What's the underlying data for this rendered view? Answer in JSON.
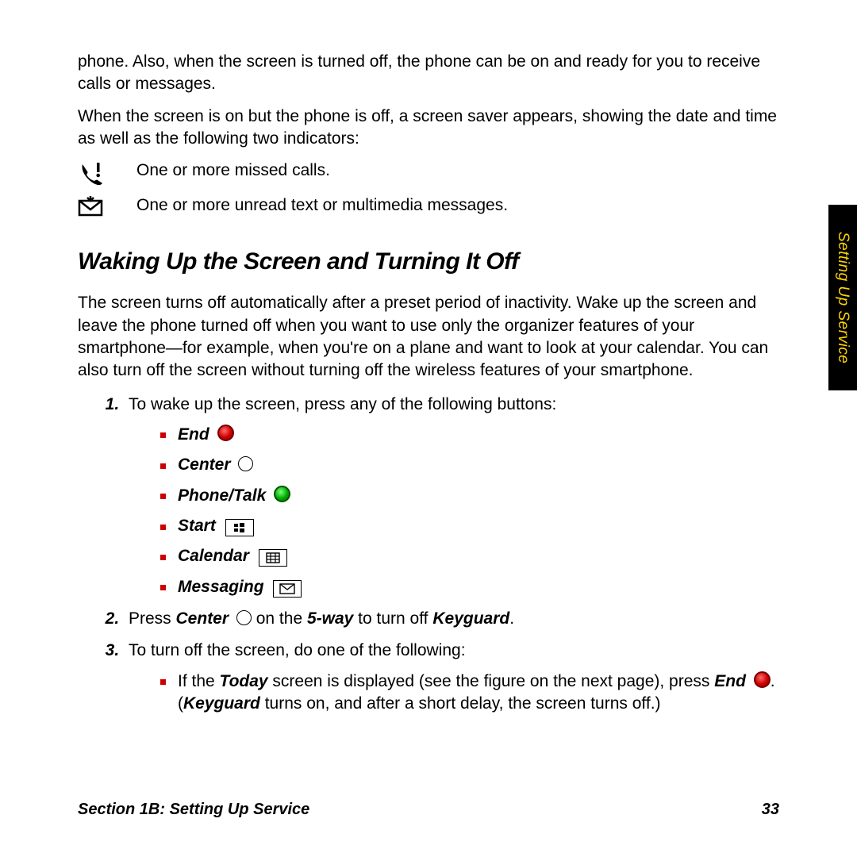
{
  "intro_paragraphs": [
    "phone. Also, when the screen is turned off, the phone can be on and ready for you to receive calls or messages.",
    "When the screen is on but the phone is off, a screen saver appears, showing the date and time as well as the following two indicators:"
  ],
  "indicators": [
    {
      "text": "One or more missed calls."
    },
    {
      "text": "One or more unread text or multimedia messages."
    }
  ],
  "heading": "Waking Up the Screen and Turning It Off",
  "section_body": "The screen turns off automatically after a preset period of inactivity. Wake up the screen and leave the phone turned off when you want to use only the organizer features of your smartphone—for example, when you're on a plane and want to look at your calendar. You can also turn off the screen without turning off the wireless features of your smartphone.",
  "steps": {
    "s1_intro": "To wake up the screen, press any of the following buttons:",
    "s1_items": [
      "End",
      "Center",
      "Phone/Talk",
      "Start",
      "Calendar",
      "Messaging"
    ],
    "s2": {
      "pre": "Press ",
      "b1": "Center",
      "mid": " on the ",
      "b2": "5-way",
      "post1": " to turn off ",
      "b3": "Keyguard",
      "post2": "."
    },
    "s3_intro": "To turn off the screen, do one of the following:",
    "s3_item": {
      "pre": "If the ",
      "b1": "Today",
      "mid": " screen is displayed (see the figure on the next page), press ",
      "b2": "End",
      "post1": ". (",
      "b3": "Keyguard",
      "post2": " turns on, and after a short delay, the screen turns off.)"
    }
  },
  "footer_left": "Section 1B: Setting Up Service",
  "footer_right": "33",
  "side_tab": "Setting Up Service"
}
